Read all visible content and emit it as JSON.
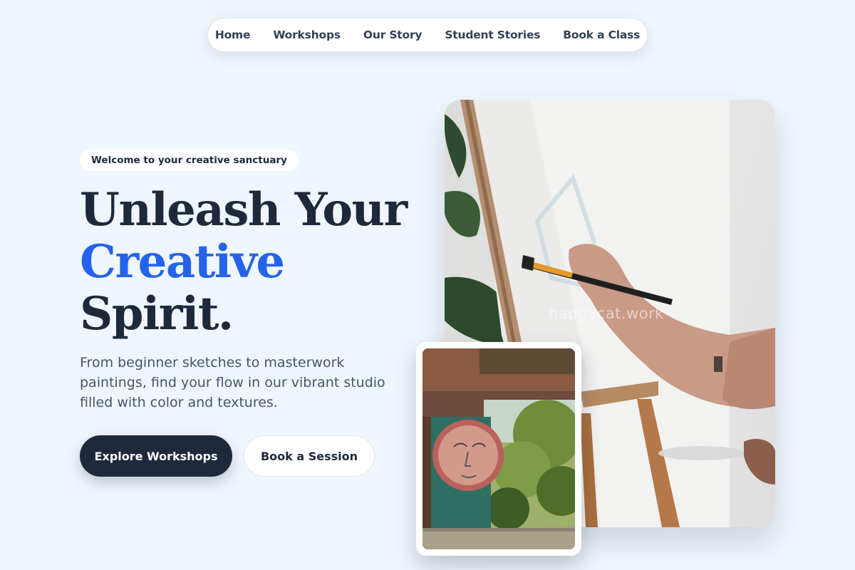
{
  "nav": {
    "items": [
      {
        "label": "Home"
      },
      {
        "label": "Workshops"
      },
      {
        "label": "Our Story"
      },
      {
        "label": "Student Stories"
      },
      {
        "label": "Book a Class"
      }
    ]
  },
  "hero": {
    "badge": "Welcome to your creative sanctuary",
    "headline_line1": "Unleash Your",
    "headline_line2": "Creative",
    "headline_line3": "Spirit.",
    "subtext": "From beginner sketches to masterwork paintings, find your flow in our vibrant studio filled with color and textures.",
    "primary_button": "Explore Workshops",
    "secondary_button": "Book a Session"
  },
  "images": {
    "main_watermark": "happycat.work"
  },
  "colors": {
    "background": "#eff6fd",
    "text_dark": "#1e293b",
    "accent": "#2563eb"
  }
}
